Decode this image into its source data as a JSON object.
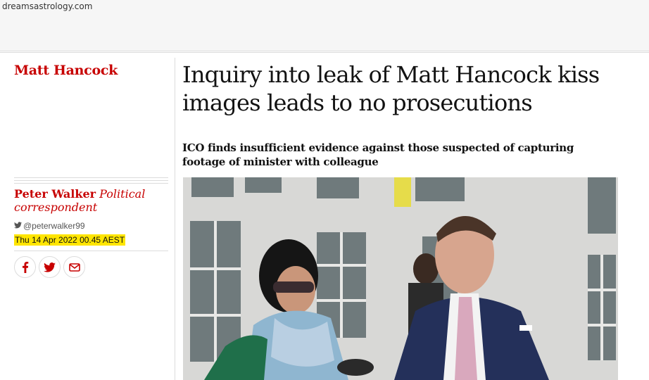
{
  "browser": {
    "site_name": "dreamsastrology.com"
  },
  "article": {
    "section": "Matt Hancock",
    "headline": "Inquiry into leak of Matt Hancock kiss images leads to no prosecutions",
    "standfirst": "ICO finds insufficient evidence against those suspected of capturing footage of minister with colleague",
    "author_name": "Peter Walker",
    "author_role": "Political correspondent",
    "twitter_handle": "@peterwalker99",
    "date": "Thu 14 Apr 2022 00.45 AEST",
    "share": [
      {
        "icon": "facebook-icon"
      },
      {
        "icon": "twitter-icon"
      },
      {
        "icon": "email-icon"
      }
    ]
  },
  "colors": {
    "brand_red": "#c70000",
    "date_highlight": "#ffe500",
    "text": "#121212"
  }
}
